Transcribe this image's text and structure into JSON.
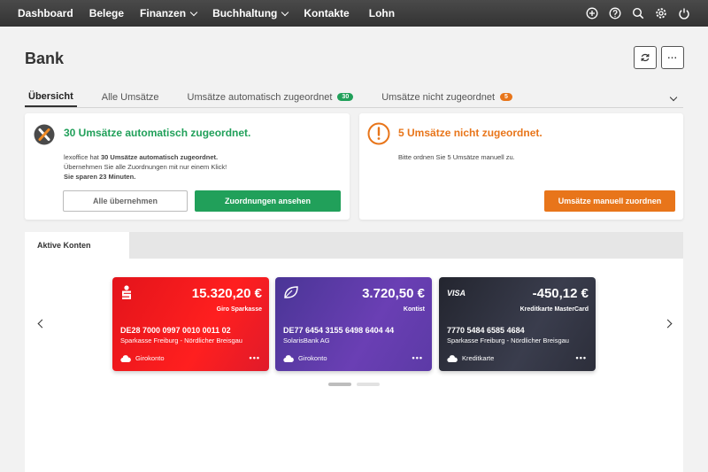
{
  "nav": {
    "items": [
      {
        "label": "Dashboard",
        "dropdown": false
      },
      {
        "label": "Belege",
        "dropdown": false
      },
      {
        "label": "Finanzen",
        "dropdown": true
      },
      {
        "label": "Buchhaltung",
        "dropdown": true
      },
      {
        "label": "Kontakte",
        "dropdown": false
      },
      {
        "label": "Lohn",
        "dropdown": false
      }
    ],
    "icons": [
      "plus-circle-icon",
      "help-icon",
      "search-icon",
      "gear-icon",
      "power-icon"
    ]
  },
  "page": {
    "title": "Bank"
  },
  "tabs": [
    {
      "label": "Übersicht",
      "active": true
    },
    {
      "label": "Alle Umsätze"
    },
    {
      "label": "Umsätze automatisch zugeordnet",
      "badge": "30",
      "badge_color": "#21a05a"
    },
    {
      "label": "Umsätze nicht zugeordnet",
      "badge": "5",
      "badge_color": "#e8751a"
    }
  ],
  "auto_card": {
    "title": "30 Umsätze automatisch zugeordnet.",
    "text_prefix": "lexoffice hat ",
    "text_bold": "30 Umsätze automatisch zugeordnet.",
    "line2": "Übernehmen Sie alle Zuordnungen mit nur einem Klick!",
    "line3": "Sie sparen 23 Minuten.",
    "btn_secondary": "Alle übernehmen",
    "btn_primary": "Zuordnungen ansehen"
  },
  "manual_card": {
    "title": "5 Umsätze nicht zugeordnet.",
    "text": "Bitte ordnen Sie 5 Umsätze manuell zu.",
    "btn": "Umsätze manuell zuordnen"
  },
  "accounts_panel": {
    "tab_label": "Aktive Konten",
    "accounts": [
      {
        "amount": "15.320,20 €",
        "label": "Giro Sparkasse",
        "iban": "DE28 7000 0997 0010 0011 02",
        "bank": "Sparkasse Freiburg - Nördlicher Breisgau",
        "type": "Girokonto",
        "logo": "sparkasse-logo"
      },
      {
        "amount": "3.720,50 €",
        "label": "Kontist",
        "iban": "DE77 6454 3155 6498 6404 44",
        "bank": "SolarisBank AG",
        "type": "Girokonto",
        "logo": "leaf-logo"
      },
      {
        "amount": "-450,12 €",
        "label": "Kreditkarte MasterCard",
        "iban": "7770 5484 6585 4684",
        "bank": "Sparkasse Freiburg - Nördlicher Breisgau",
        "type": "Kreditkarte",
        "logo": "VISA"
      }
    ],
    "more": "•••"
  },
  "colors": {
    "green": "#21a05a",
    "orange": "#e8751a",
    "red": "#e3141b",
    "purple": "#5a3fa8",
    "dark": "#2e3040"
  }
}
